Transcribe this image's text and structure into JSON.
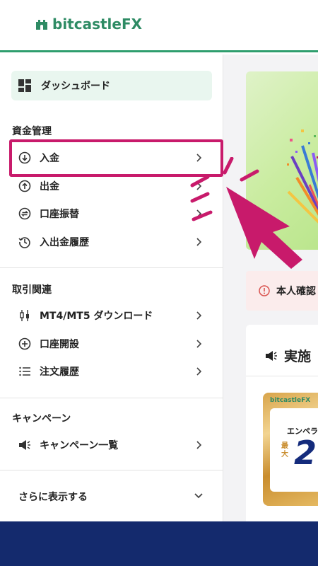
{
  "header": {
    "logo_text": "bitcastleFX",
    "brand_color": "#2e8b64"
  },
  "sidebar": {
    "dashboard": {
      "label": "ダッシュボード",
      "icon": "dashboard-icon"
    },
    "sections": [
      {
        "title": "資金管理",
        "items": [
          {
            "label": "入金",
            "icon": "deposit-icon",
            "highlighted": true
          },
          {
            "label": "出金",
            "icon": "withdraw-icon"
          },
          {
            "label": "口座振替",
            "icon": "transfer-icon"
          },
          {
            "label": "入出金履歴",
            "icon": "history-icon"
          }
        ]
      },
      {
        "title": "取引関連",
        "items": [
          {
            "label": "MT4/MT5 ダウンロード",
            "icon": "candlestick-icon"
          },
          {
            "label": "口座開設",
            "icon": "plus-circle-icon"
          },
          {
            "label": "注文履歴",
            "icon": "list-icon"
          }
        ]
      },
      {
        "title": "キャンペーン",
        "items": [
          {
            "label": "キャンペーン一覧",
            "icon": "megaphone-icon"
          }
        ]
      }
    ],
    "more_label": "さらに表示する",
    "highlight_color": "#c81a6b"
  },
  "main": {
    "verify_text": "本人確認",
    "campaign_title": "実施",
    "promo": {
      "logo": "bitcastleFX",
      "sub": "エンペラ",
      "max": "最大",
      "number": "2"
    }
  },
  "footer": {
    "color": "#142a6d"
  }
}
